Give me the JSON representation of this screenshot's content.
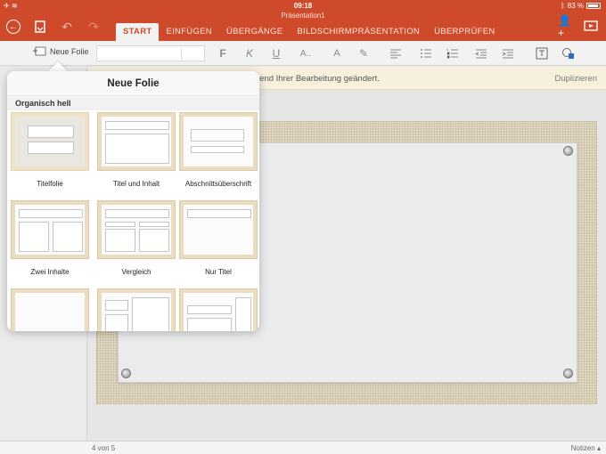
{
  "status": {
    "time": "09:18",
    "battery_text": "83 %"
  },
  "document": {
    "title": "Präsentation1"
  },
  "ribbon": {
    "tabs": [
      {
        "label": "START",
        "active": true
      },
      {
        "label": "EINFÜGEN"
      },
      {
        "label": "ÜBERGÄNGE"
      },
      {
        "label": "BILDSCHIRMPRÄSENTATION"
      },
      {
        "label": "ÜBERPRÜFEN"
      }
    ]
  },
  "toolbar": {
    "new_slide_label": "Neue Folie",
    "bold_label": "F",
    "italic_label": "K",
    "underline_label": "U",
    "font_size_label": "A..",
    "font_color_label": "A"
  },
  "infobar": {
    "message": "rend Ihrer Bearbeitung geändert.",
    "duplicate_label": "Duplizieren"
  },
  "popover": {
    "title": "Neue Folie",
    "section": "Organisch hell",
    "layouts": [
      {
        "label": "Titelfolie"
      },
      {
        "label": "Titel und Inhalt"
      },
      {
        "label": "Abschnittsüberschrift"
      },
      {
        "label": "Zwei Inhalte"
      },
      {
        "label": "Vergleich"
      },
      {
        "label": "Nur Titel"
      },
      {
        "label": ""
      },
      {
        "label": ""
      },
      {
        "label": ""
      }
    ]
  },
  "footer": {
    "slide_count": "4 von 5",
    "notes_label": "Notizen"
  },
  "colors": {
    "accent": "#cf4a2a",
    "info_bg": "#f6f0dc"
  }
}
